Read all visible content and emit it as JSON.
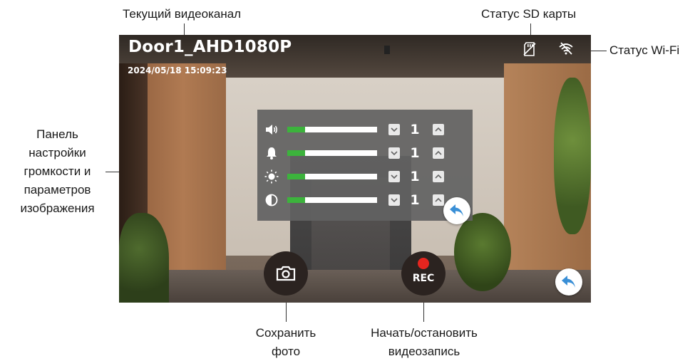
{
  "callouts": {
    "current_channel": "Текущий видеоканал",
    "sd_status": "Статус SD карты",
    "wifi_status": "Статус Wi-Fi",
    "settings_panel": [
      "Панель",
      "настройки",
      "громкости и",
      "параметров",
      "изображения"
    ],
    "save_photo": [
      "Сохранить",
      "фото"
    ],
    "start_stop_record": [
      "Начать/остановить",
      "видеозапись"
    ]
  },
  "screen": {
    "channel_name": "Door1_AHD1080P",
    "timestamp": "2024/05/18 15:09:23",
    "sd_icon": "sd-card-icon",
    "wifi_icon": "wifi-icon",
    "settings": {
      "rows": [
        {
          "icon": "speaker-icon",
          "value": "1",
          "level": 0.2
        },
        {
          "icon": "bell-icon",
          "value": "1",
          "level": 0.2
        },
        {
          "icon": "brightness-icon",
          "value": "1",
          "level": 0.2
        },
        {
          "icon": "contrast-icon",
          "value": "1",
          "level": 0.2
        }
      ]
    },
    "buttons": {
      "photo_icon": "camera-icon",
      "rec_label": "REC",
      "back_icon": "back-arrow-icon"
    }
  },
  "colors": {
    "level_fill": "#3cb33c",
    "rec_dot": "#e5251f",
    "panel_bg": "#626262"
  }
}
